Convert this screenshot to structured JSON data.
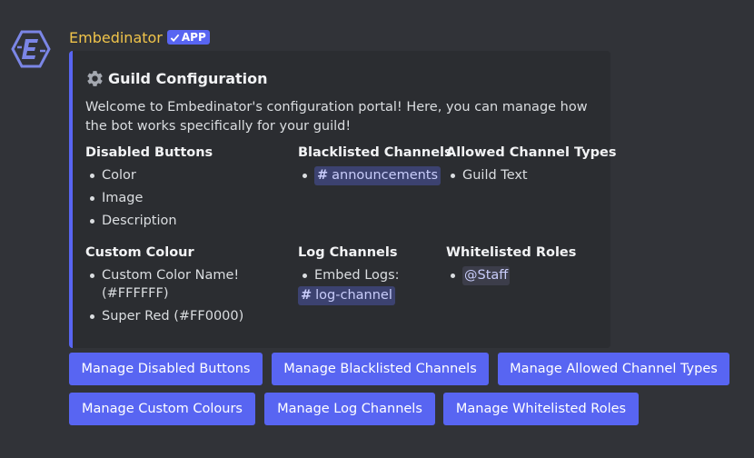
{
  "message": {
    "author": "Embedinator",
    "badge": "APP",
    "avatar_icon": "embedinator-logo-icon"
  },
  "embed": {
    "accent_color": "#5865f2",
    "title_icon": "gear-icon",
    "title": "Guild Configuration",
    "description": "Welcome to Embedinator's configuration portal! Here, you can manage how the bot works specifically for your guild!",
    "fields": {
      "disabled_buttons": {
        "name": "Disabled Buttons",
        "items": [
          "Color",
          "Image",
          "Description"
        ]
      },
      "blacklisted_channels": {
        "name": "Blacklisted Channels",
        "items": [
          "announcements"
        ]
      },
      "allowed_channel_types": {
        "name": "Allowed Channel Types",
        "items": [
          "Guild Text"
        ]
      },
      "custom_colour": {
        "name": "Custom Colour",
        "items": [
          "Custom Color Name! (#FFFFFF)",
          "Super Red (#FF0000)"
        ]
      },
      "log_channels": {
        "name": "Log Channels",
        "item_label": "Embed Logs:",
        "item_channel": "log-channel"
      },
      "whitelisted_roles": {
        "name": "Whitelisted Roles",
        "items": [
          "@Staff"
        ]
      }
    }
  },
  "buttons": {
    "row1": [
      "Manage Disabled Buttons",
      "Manage Blacklisted Channels",
      "Manage Allowed Channel Types"
    ],
    "row2": [
      "Manage Custom Colours",
      "Manage Log Channels",
      "Manage Whitelisted Roles"
    ]
  }
}
